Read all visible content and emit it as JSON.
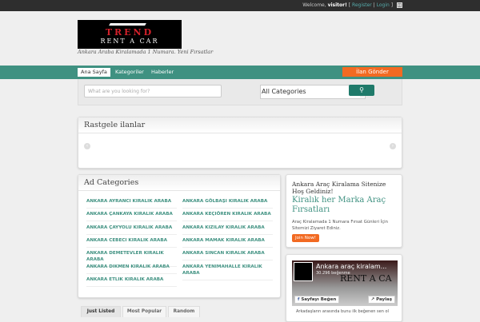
{
  "topbar": {
    "welcome": "Welcome,",
    "user": "visitor!",
    "sep1": "[",
    "register": "Register",
    "sep2": "|",
    "login": "Login",
    "sep3": "]"
  },
  "logo": {
    "line1": "TREND",
    "line2": "RENT A CAR"
  },
  "tagline": "Ankara Araba Kiralamada 1 Numara. Yeni Fırsatlar",
  "nav": {
    "items": [
      "Ana Sayfa",
      "Kategoriler",
      "Haberler"
    ],
    "cta": "İlan Gönder"
  },
  "search": {
    "placeholder": "What are you looking for?",
    "category": "All Categories"
  },
  "random": {
    "title": "Rastgele ilanlar"
  },
  "categories": {
    "title": "Ad Categories",
    "left": [
      "ANKARA AYRANCI KIRALIK ARABA",
      "ANKARA ÇANKAYA KIRALIK ARABA",
      "ANKARA ÇAYYOLU KIRALIK ARABA",
      "ANKARA CEBECI KIRALIK ARABA",
      "ANKARA DEMETEVLER KIRALIK ARABA",
      "ANKARA DIKMEN KIRALIK ARABA",
      "ANKARA ETLIK KIRALIK ARABA"
    ],
    "right": [
      "ANKARA GÖLBAŞI KIRALIK ARABA",
      "ANKARA KEÇIÖREN KIRALIK ARABA",
      "ANKARA KIZILAY KIRALIK ARABA",
      "ANKARA MAMAK KIRALIK ARABA",
      "ANKARA SINCAN KIRALIK ARABA",
      "ANKARA YENIMAHALLE KIRALIK ARABA"
    ]
  },
  "welcome": {
    "heading": "Ankara Araç Kiralama Sitenize Hoş Geldiniz!",
    "subheading": "Kiralık her Marka Araç Fırsatları",
    "text": "Araç Kiralamada 1 Numara Fırsat Günleri İçin Sitemizi Ziyaret Ediniz.",
    "button": "Join Now!"
  },
  "facebook": {
    "page_name": "Ankara araç kiralam...",
    "likes": "30.296 beğenme",
    "cover_text": "RENT A CA",
    "like_button": "Sayfayı Beğen",
    "share_button": "Paylaş",
    "friends_text": "Arkadaşların arasında bunu ilk beğenen sen ol"
  },
  "tabs": [
    "Just Listed",
    "Most Popular",
    "Random"
  ]
}
